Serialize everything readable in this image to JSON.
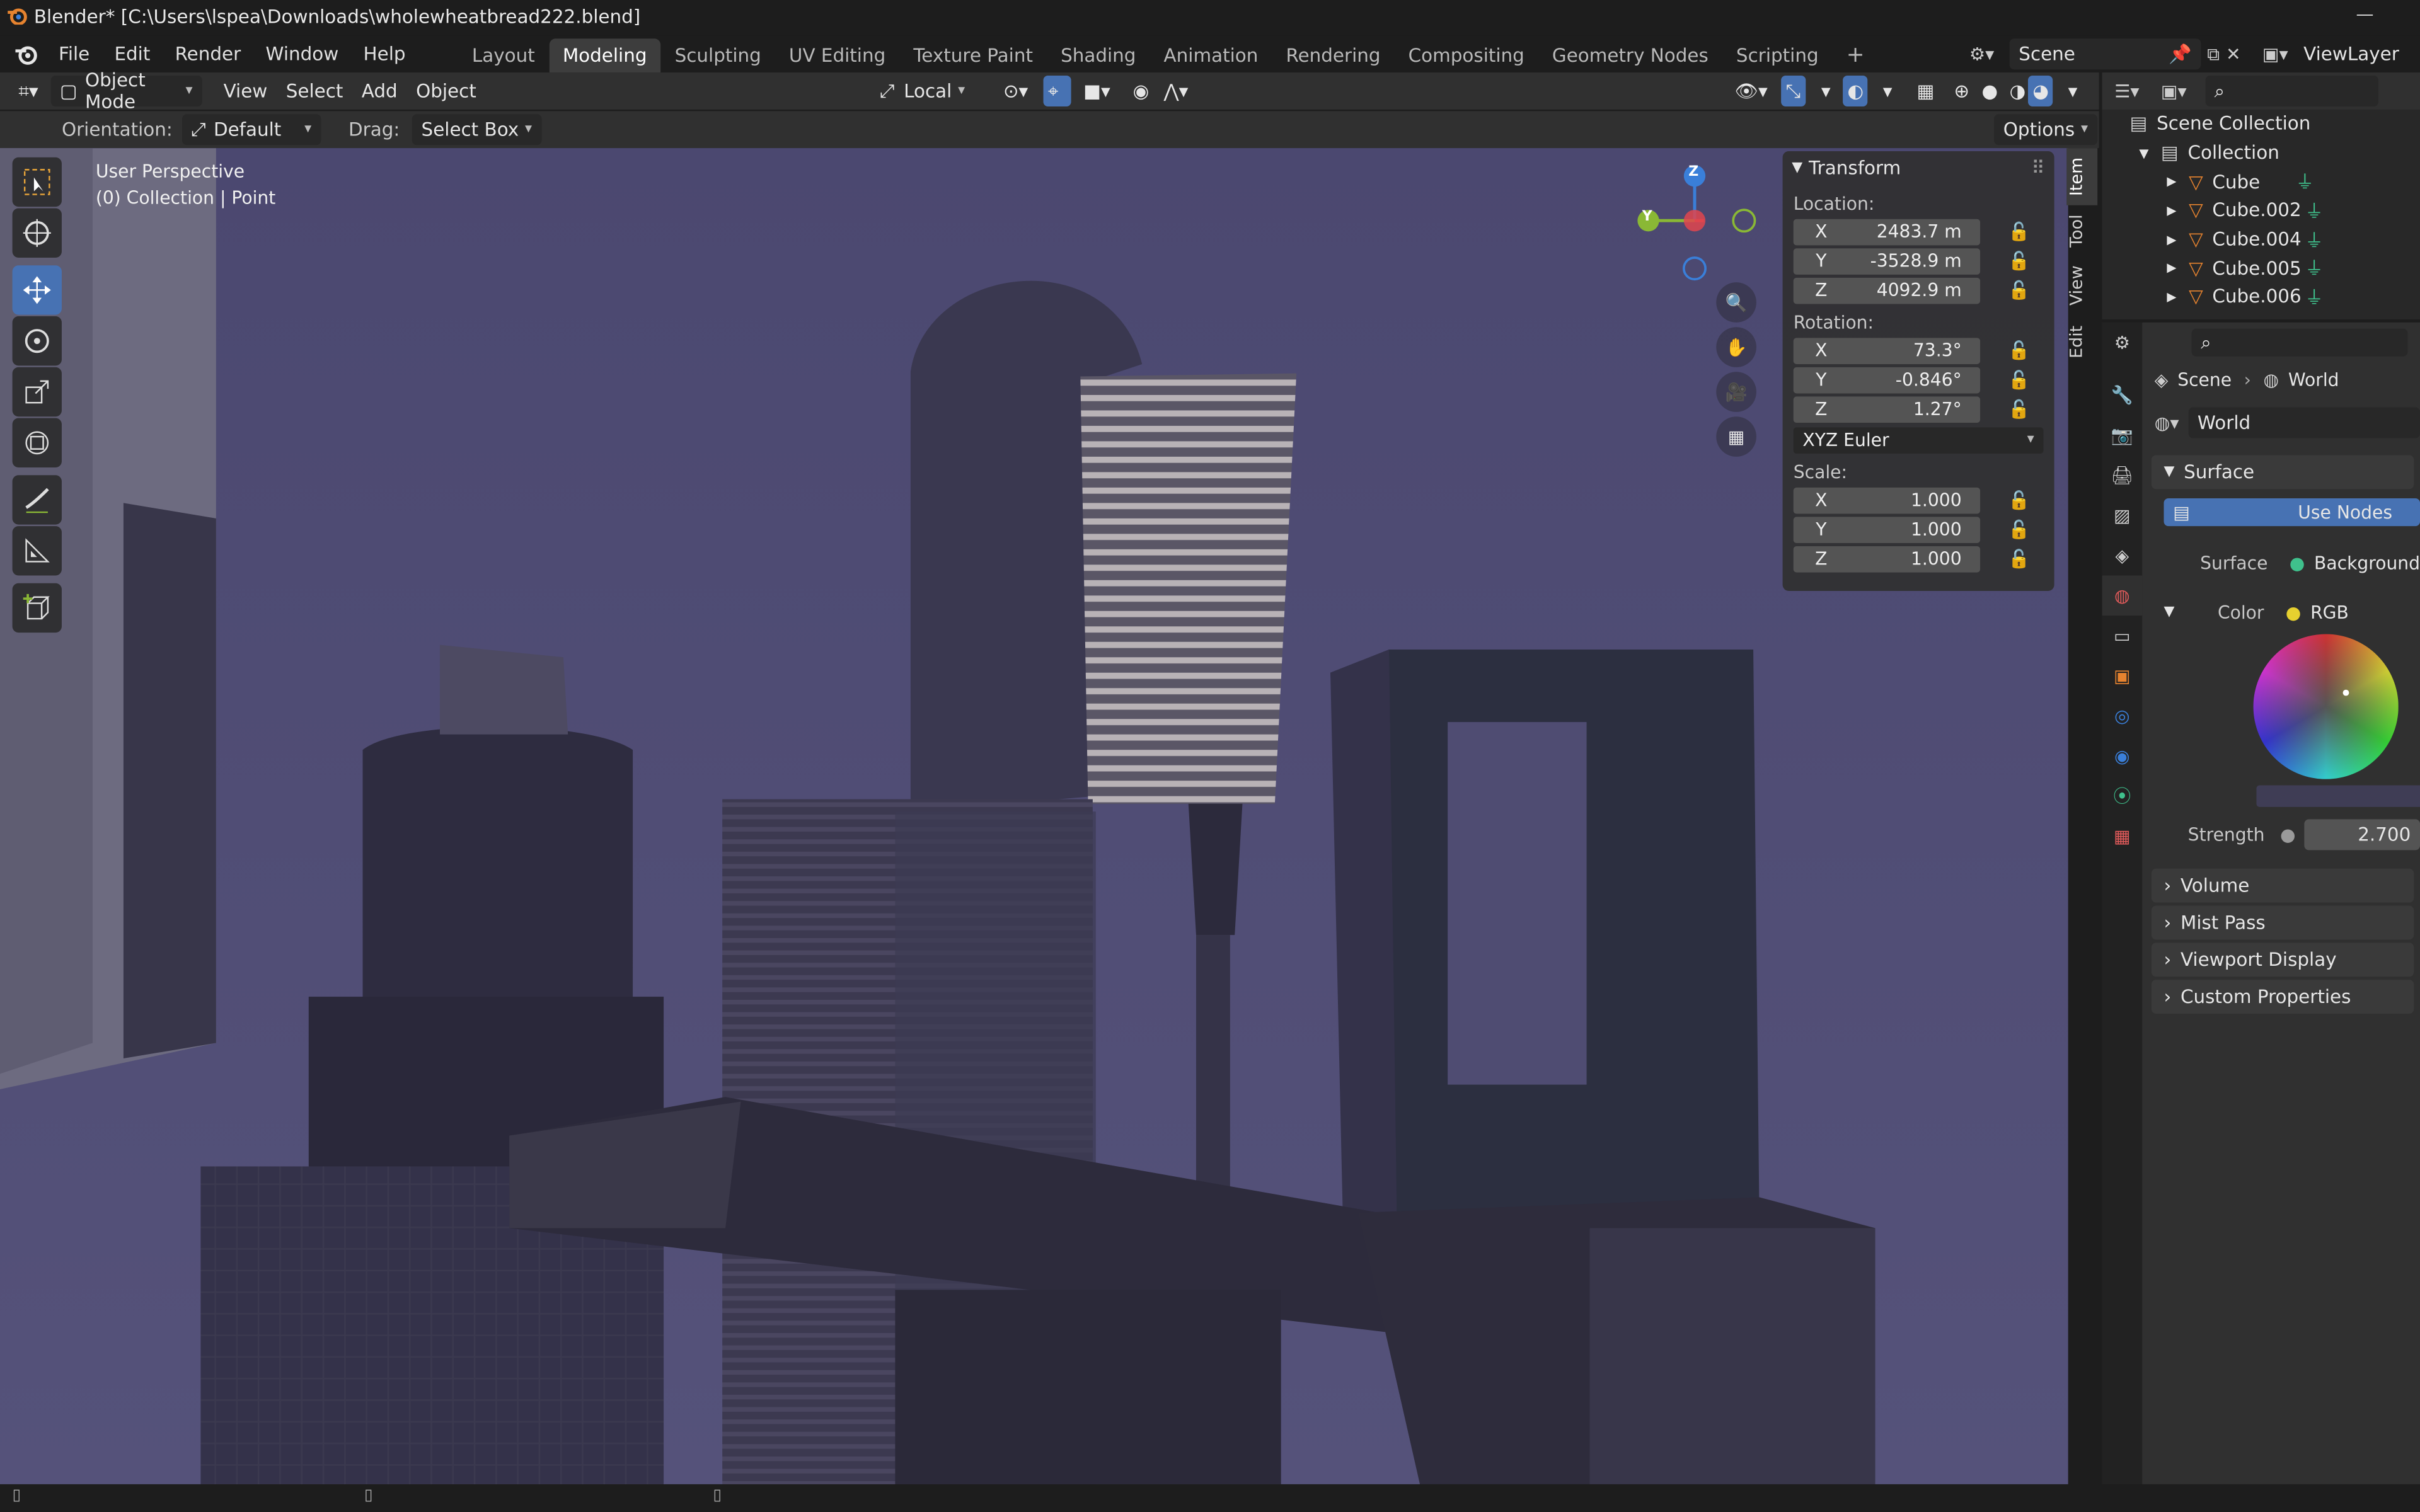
{
  "window": {
    "title": "Blender* [C:\\Users\\lspea\\Downloads\\wholewheatbread222.blend]"
  },
  "menu": [
    "File",
    "Edit",
    "Render",
    "Window",
    "Help"
  ],
  "workspaces": [
    "Layout",
    "Modeling",
    "Sculpting",
    "UV Editing",
    "Texture Paint",
    "Shading",
    "Animation",
    "Rendering",
    "Compositing",
    "Geometry Nodes",
    "Scripting"
  ],
  "active_workspace": "Modeling",
  "scene_name": "Scene",
  "view_layer": "ViewLayer",
  "header": {
    "mode": "Object Mode",
    "view": "View",
    "select": "Select",
    "add": "Add",
    "object": "Object",
    "transform_space": "Local"
  },
  "tool_settings": {
    "orientation_label": "Orientation:",
    "orientation_value": "Default",
    "drag_label": "Drag:",
    "drag_value": "Select Box",
    "options": "Options"
  },
  "viewport": {
    "line1": "User Perspective",
    "line2": "(0) Collection | Point",
    "gizmo": {
      "z": "Z",
      "y": "Y"
    }
  },
  "transform": {
    "title": "Transform",
    "location_label": "Location:",
    "location": [
      {
        "axis": "X",
        "value": "2483.7 m"
      },
      {
        "axis": "Y",
        "value": "-3528.9 m"
      },
      {
        "axis": "Z",
        "value": "4092.9 m"
      }
    ],
    "rotation_label": "Rotation:",
    "rotation": [
      {
        "axis": "X",
        "value": "73.3°"
      },
      {
        "axis": "Y",
        "value": "-0.846°"
      },
      {
        "axis": "Z",
        "value": "1.27°"
      }
    ],
    "rotation_mode": "XYZ Euler",
    "scale_label": "Scale:",
    "scale": [
      {
        "axis": "X",
        "value": "1.000"
      },
      {
        "axis": "Y",
        "value": "1.000"
      },
      {
        "axis": "Z",
        "value": "1.000"
      }
    ]
  },
  "side_tabs": [
    "Item",
    "Tool",
    "View",
    "Edit"
  ],
  "outliner": {
    "root": "Scene Collection",
    "collection": "Collection",
    "items": [
      "Cube",
      "Cube.002",
      "Cube.004",
      "Cube.005",
      "Cube.006"
    ]
  },
  "properties": {
    "breadcrumb_scene": "Scene",
    "breadcrumb_world": "World",
    "world_name": "World",
    "surface_panel": "Surface",
    "use_nodes": "Use Nodes",
    "surface_label": "Surface",
    "surface_value": "Background",
    "color_label": "Color",
    "color_value": "RGB",
    "strength_label": "Strength",
    "strength_value": "2.700",
    "panels": [
      "Volume",
      "Mist Pass",
      "Viewport Display",
      "Custom Properties"
    ]
  },
  "colors": {
    "accent": "#4772b3",
    "viewport_bg": "#4c4a6e",
    "axis_x": "#e0454d",
    "axis_y": "#8ab835",
    "axis_z": "#3a7fd9"
  }
}
